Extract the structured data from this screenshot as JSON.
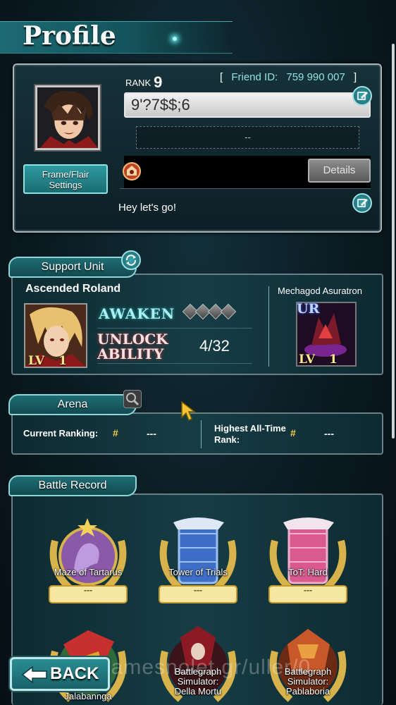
{
  "header": {
    "title": "Profile"
  },
  "profile": {
    "rank_label": "RANK",
    "rank_value": "9",
    "friend_bracket_open": "[",
    "friend_id_label": "Friend ID:",
    "friend_id_value": "759 990 007",
    "friend_bracket_close": "]",
    "player_name": "9'?7$$;6",
    "guild_text": "--",
    "frame_button_line1": "Frame/Flair",
    "frame_button_line2": "Settings",
    "details_button": "Details",
    "comment": "Hey let's go!"
  },
  "support_unit": {
    "section_title": "Support Unit",
    "unit_name": "Ascended Roland",
    "unit_lv_label": "LV",
    "unit_lv_value": "1",
    "awaken_label": "AWAKEN",
    "awaken_filled": 0,
    "awaken_total": 4,
    "unlock_line1": "UNLOCK",
    "unlock_line2": "ABILITY",
    "unlock_count": "4/32",
    "equip_name": "Mechagod Asuratron",
    "equip_rarity": "UR",
    "equip_lv_label": "LV",
    "equip_lv_value": "1"
  },
  "arena": {
    "section_title": "Arena",
    "current_label": "Current Ranking:",
    "current_symbol": "#",
    "current_value": "---",
    "highest_label_line1": "Highest All-Time",
    "highest_label_line2": "Rank:",
    "highest_symbol": "#",
    "highest_value": "---"
  },
  "battle_record": {
    "section_title": "Battle Record",
    "row1": [
      {
        "name": "Maze of Tartarus",
        "value": "---"
      },
      {
        "name": "Tower of Trials",
        "value": "---"
      },
      {
        "name": "ToT: Hard",
        "value": "---"
      }
    ],
    "row2": [
      {
        "name_line1": "",
        "name_line2": "",
        "name_line3": "Jalabannga"
      },
      {
        "name_line1": "Battlegraph",
        "name_line2": "Simulator:",
        "name_line3": "Della Mortu"
      },
      {
        "name_line1": "Battlegraph",
        "name_line2": "Simulator:",
        "name_line3": "Pablaboria"
      }
    ]
  },
  "footer": {
    "back_label": "BACK",
    "watermark": "gamesnolet.gr/uller/0"
  },
  "colors": {
    "accent": "#8fe3e3",
    "gold": "#ffcc44",
    "panel": "#0e2a31"
  }
}
